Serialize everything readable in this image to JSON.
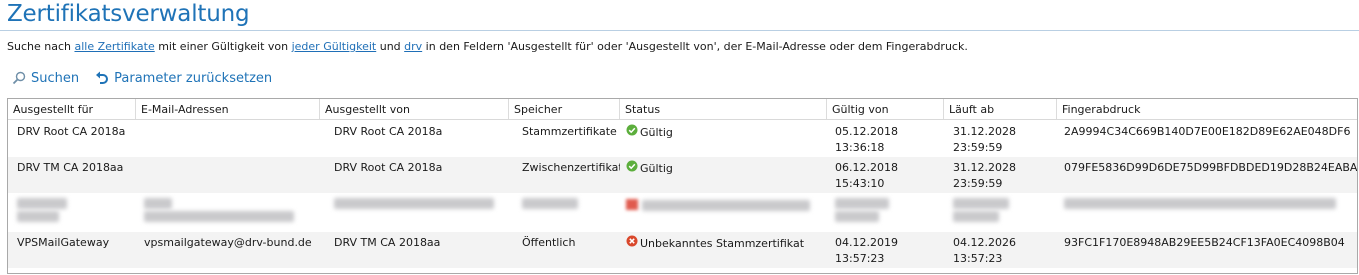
{
  "page": {
    "title": "Zertifikatsverwaltung"
  },
  "search": {
    "text1": "Suche nach ",
    "link_certs": "alle Zertifikate",
    "text2": " mit einer Gültigkeit von ",
    "link_validity": "jeder Gültigkeit",
    "text3": " und ",
    "link_term": "drv",
    "text4": " in den Feldern 'Ausgestellt für' oder 'Ausgestellt von', der E-Mail-Adresse oder dem Fingerabdruck."
  },
  "toolbar": {
    "search_label": "Suchen",
    "reset_label": "Parameter zurücksetzen"
  },
  "columns": [
    "Ausgestellt für",
    "E-Mail-Adressen",
    "Ausgestellt von",
    "Speicher",
    "Status",
    "Gültig von",
    "Läuft ab",
    "Fingerabdruck"
  ],
  "rows": [
    {
      "issued_for": "DRV Root CA 2018a",
      "email": "",
      "issued_by": "DRV Root CA 2018a",
      "store": "Stammzertifikate",
      "status": "Gültig",
      "status_icon": "check-circle-icon",
      "valid_from_date": "05.12.2018",
      "valid_from_time": "13:36:18",
      "expires_date": "31.12.2028",
      "expires_time": "23:59:59",
      "fingerprint": "2A9994C34C669B140D7E00E182D89E62AE048DF6"
    },
    {
      "issued_for": "DRV TM CA 2018aa",
      "email": "",
      "issued_by": "DRV Root CA 2018a",
      "store": "Zwischenzertifikate",
      "status": "Gültig",
      "status_icon": "check-circle-icon",
      "valid_from_date": "06.12.2018",
      "valid_from_time": "15:43:10",
      "expires_date": "31.12.2028",
      "expires_time": "23:59:59",
      "fingerprint": "079FE5836D99D6DE75D99BFDBDED19D28B24EABA"
    },
    {
      "redacted": true
    },
    {
      "issued_for": "VPSMailGateway",
      "email": "vpsmailgateway@drv-bund.de",
      "issued_by": "DRV TM CA 2018aa",
      "store": "Öffentlich",
      "status": "Unbekanntes Stammzertifikat",
      "status_icon": "error-circle-icon",
      "valid_from_date": "04.12.2019",
      "valid_from_time": "13:57:23",
      "expires_date": "04.12.2026",
      "expires_time": "13:57:23",
      "fingerprint": "93FC1F170E8948AB29EE5B24CF13FA0EC4098B04"
    }
  ],
  "colors": {
    "accent": "#1f73b7",
    "valid_green": "#5cae3c",
    "error_red": "#d9472b"
  }
}
